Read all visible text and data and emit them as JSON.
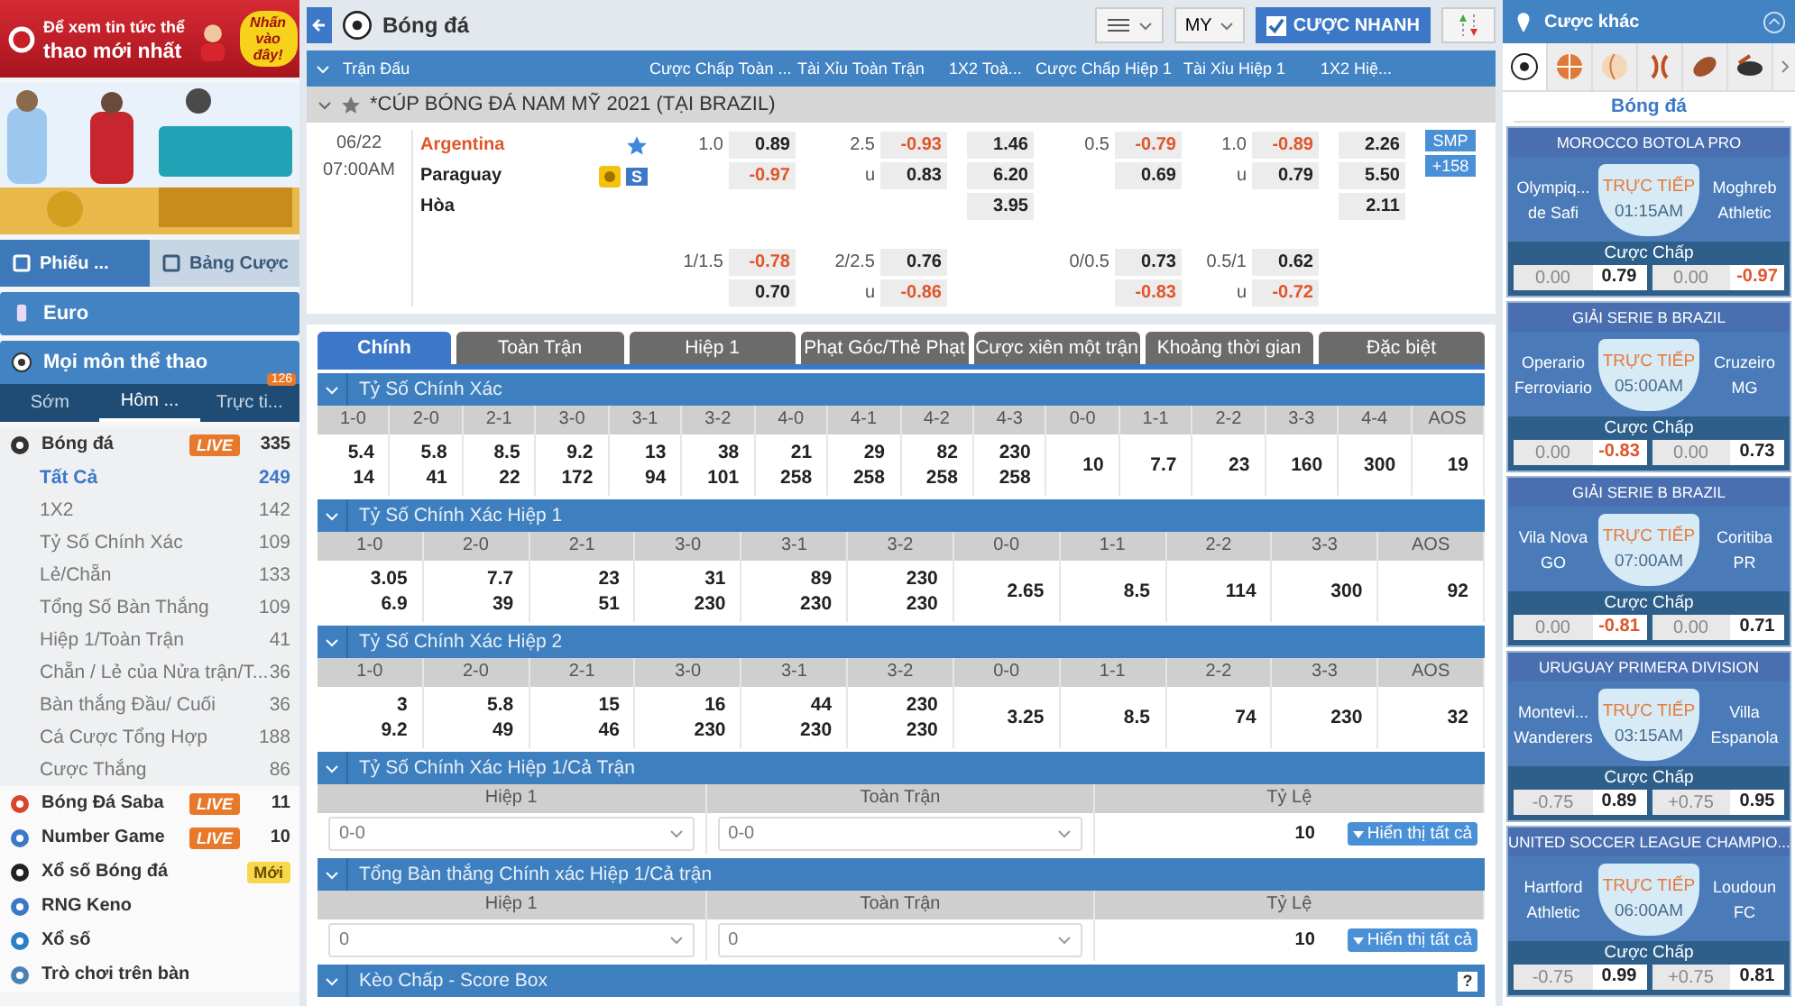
{
  "sidebar": {
    "promo_banner": {
      "line_1": "Để xem tin tức thể",
      "line_2": "thao mới nhất",
      "callout": "Nhấn vào đây!"
    },
    "slip_tabs": [
      {
        "label": "Phiếu ...",
        "selected": true
      },
      {
        "label": "Bảng Cược",
        "selected": false
      }
    ],
    "euro": "Euro",
    "all_sports": "Mọi môn thể thao",
    "period_tabs": [
      {
        "label": "Sớm",
        "selected": false
      },
      {
        "label": "Hôm ...",
        "selected": true
      },
      {
        "label": "Trực ti...",
        "selected": false,
        "badge": "126"
      }
    ],
    "sports": [
      {
        "name": "Bóng đá",
        "badge": {
          "kind": "live",
          "text": "LIVE"
        },
        "count": "335",
        "expanded": true,
        "children": [
          {
            "name": "Tất Cả",
            "count": "249",
            "selected": true
          },
          {
            "name": "1X2",
            "count": "142",
            "selected": false
          },
          {
            "name": "Tỷ Số Chính Xác",
            "count": "109",
            "selected": false
          },
          {
            "name": "Lẻ/Chẵn",
            "count": "133",
            "selected": false
          },
          {
            "name": "Tổng Số Bàn Thắng",
            "count": "109",
            "selected": false
          },
          {
            "name": "Hiệp 1/Toàn Trận",
            "count": "41",
            "selected": false
          },
          {
            "name": "Chẵn / Lẻ của Nửa trận/T...",
            "count": "36",
            "selected": false
          },
          {
            "name": "Bàn thắng Đầu/ Cuối",
            "count": "36",
            "selected": false
          },
          {
            "name": "Cá Cược Tổng Hợp",
            "count": "188",
            "selected": false
          },
          {
            "name": "Cược Thắng",
            "count": "86",
            "selected": false
          }
        ]
      },
      {
        "name": "Bóng Đá Saba",
        "badge": {
          "kind": "live",
          "text": "LIVE"
        },
        "count": "11",
        "expanded": false
      },
      {
        "name": "Number Game",
        "badge": {
          "kind": "live",
          "text": "LIVE"
        },
        "count": "10",
        "expanded": false
      },
      {
        "name": "Xổ số Bóng đá",
        "badge": {
          "kind": "new",
          "text": "Mới"
        },
        "expanded": false
      },
      {
        "name": "RNG Keno",
        "expanded": false
      },
      {
        "name": "Xổ số",
        "expanded": false
      },
      {
        "name": "Trò chơi trên bàn",
        "expanded": false
      }
    ]
  },
  "header": {
    "title": "Bóng đá",
    "odds_format": "MY",
    "quick_bet": {
      "label": "CƯỢC NHANH",
      "checked": true
    }
  },
  "columns": [
    "Trận Đấu",
    "Cược Chấp Toàn ...",
    "Tài Xỉu Toàn Trận",
    "1X2 Toà...",
    "Cược Chấp Hiệp 1",
    "Tài Xỉu Hiệp 1",
    "1X2 Hiệ..."
  ],
  "league": "*CÚP BÓNG ĐÁ NAM MỸ 2021 (TẠI BRAZIL)",
  "match": {
    "date": "06/22",
    "time": "07:00AM",
    "teams": [
      {
        "name": "Argentina",
        "favored": true,
        "starred": true,
        "streaming": false
      },
      {
        "name": "Paraguay",
        "favored": false,
        "starred": false,
        "streaming": true,
        "tag": "S"
      },
      {
        "name": "Hòa",
        "favored": false,
        "starred": false,
        "streaming": false
      }
    ],
    "markets": [
      {
        "rows": [
          {
            "line": "1.0",
            "odds": "0.89"
          },
          {
            "odds": "-0.97"
          },
          {},
          {
            "line": "1/1.5",
            "odds": "-0.78"
          },
          {
            "odds": "0.70"
          }
        ]
      },
      {
        "rows": [
          {
            "line": "2.5",
            "odds": "-0.93"
          },
          {
            "line": "u",
            "odds": "0.83"
          },
          {},
          {
            "line": "2/2.5",
            "odds": "0.76"
          },
          {
            "line": "u",
            "odds": "-0.86"
          }
        ]
      },
      {
        "rows": [
          {
            "odds": "1.46"
          },
          {
            "odds": "6.20"
          },
          {
            "odds": "3.95"
          },
          {},
          {}
        ]
      },
      {
        "rows": [
          {
            "line": "0.5",
            "odds": "-0.79"
          },
          {
            "odds": "0.69"
          },
          {},
          {
            "line": "0/0.5",
            "odds": "0.73"
          },
          {
            "odds": "-0.83"
          }
        ]
      },
      {
        "rows": [
          {
            "line": "1.0",
            "odds": "-0.89"
          },
          {
            "line": "u",
            "odds": "0.79"
          },
          {},
          {
            "line": "0.5/1",
            "odds": "0.62"
          },
          {
            "line": "u",
            "odds": "-0.72"
          }
        ]
      },
      {
        "rows": [
          {
            "odds": "2.26"
          },
          {
            "odds": "5.50"
          },
          {
            "odds": "2.11"
          },
          {},
          {}
        ]
      }
    ],
    "smp": "SMP",
    "more": "+158"
  },
  "bet_tabs": [
    {
      "label": "Chính",
      "selected": true
    },
    {
      "label": "Toàn Trận",
      "selected": false
    },
    {
      "label": "Hiệp 1",
      "selected": false
    },
    {
      "label": "Phạt Góc/Thẻ Phạt",
      "selected": false
    },
    {
      "label": "Cược xiên một trận",
      "selected": false
    },
    {
      "label": "Khoảng thời gian",
      "selected": false
    },
    {
      "label": "Đặc biệt",
      "selected": false
    }
  ],
  "sections": [
    {
      "kind": "grid",
      "title": "Tỷ Số Chính Xác",
      "cells": [
        {
          "score": "1-0",
          "odds": [
            "5.4",
            "14"
          ]
        },
        {
          "score": "2-0",
          "odds": [
            "5.8",
            "41"
          ]
        },
        {
          "score": "2-1",
          "odds": [
            "8.5",
            "22"
          ]
        },
        {
          "score": "3-0",
          "odds": [
            "9.2",
            "172"
          ]
        },
        {
          "score": "3-1",
          "odds": [
            "13",
            "94"
          ]
        },
        {
          "score": "3-2",
          "odds": [
            "38",
            "101"
          ]
        },
        {
          "score": "4-0",
          "odds": [
            "21",
            "258"
          ]
        },
        {
          "score": "4-1",
          "odds": [
            "29",
            "258"
          ]
        },
        {
          "score": "4-2",
          "odds": [
            "82",
            "258"
          ]
        },
        {
          "score": "4-3",
          "odds": [
            "230",
            "258"
          ]
        },
        {
          "score": "0-0",
          "odds": [
            "10"
          ]
        },
        {
          "score": "1-1",
          "odds": [
            "7.7"
          ]
        },
        {
          "score": "2-2",
          "odds": [
            "23"
          ]
        },
        {
          "score": "3-3",
          "odds": [
            "160"
          ]
        },
        {
          "score": "4-4",
          "odds": [
            "300"
          ]
        },
        {
          "score": "AOS",
          "odds": [
            "19"
          ]
        }
      ]
    },
    {
      "kind": "grid",
      "title": "Tỷ Số Chính Xác Hiệp 1",
      "cells": [
        {
          "score": "1-0",
          "odds": [
            "3.05",
            "6.9"
          ]
        },
        {
          "score": "2-0",
          "odds": [
            "7.7",
            "39"
          ]
        },
        {
          "score": "2-1",
          "odds": [
            "23",
            "51"
          ]
        },
        {
          "score": "3-0",
          "odds": [
            "31",
            "230"
          ]
        },
        {
          "score": "3-1",
          "odds": [
            "89",
            "230"
          ]
        },
        {
          "score": "3-2",
          "odds": [
            "230",
            "230"
          ]
        },
        {
          "score": "0-0",
          "odds": [
            "2.65"
          ]
        },
        {
          "score": "1-1",
          "odds": [
            "8.5"
          ]
        },
        {
          "score": "2-2",
          "odds": [
            "114"
          ]
        },
        {
          "score": "3-3",
          "odds": [
            "300"
          ]
        },
        {
          "score": "AOS",
          "odds": [
            "92"
          ]
        }
      ]
    },
    {
      "kind": "grid",
      "title": "Tỷ Số Chính Xác Hiệp 2",
      "cells": [
        {
          "score": "1-0",
          "odds": [
            "3",
            "9.2"
          ]
        },
        {
          "score": "2-0",
          "odds": [
            "5.8",
            "49"
          ]
        },
        {
          "score": "2-1",
          "odds": [
            "15",
            "46"
          ]
        },
        {
          "score": "3-0",
          "odds": [
            "16",
            "230"
          ]
        },
        {
          "score": "3-1",
          "odds": [
            "44",
            "230"
          ]
        },
        {
          "score": "3-2",
          "odds": [
            "230",
            "230"
          ]
        },
        {
          "score": "0-0",
          "odds": [
            "3.25"
          ]
        },
        {
          "score": "1-1",
          "odds": [
            "8.5"
          ]
        },
        {
          "score": "2-2",
          "odds": [
            "74"
          ]
        },
        {
          "score": "3-3",
          "odds": [
            "230"
          ]
        },
        {
          "score": "AOS",
          "odds": [
            "32"
          ]
        }
      ]
    },
    {
      "kind": "combo",
      "title": "Tỷ Số Chính Xác Hiệp 1/Cả Trận",
      "columns": [
        "Hiệp 1",
        "Toàn Trận",
        "Tỷ Lệ"
      ],
      "selects": [
        "0-0",
        "0-0"
      ],
      "ratio": "10",
      "show_all": "Hiển thị tất cả"
    },
    {
      "kind": "combo",
      "title": "Tổng Bàn thắng Chính xác Hiệp 1/Cả trận",
      "columns": [
        "Hiệp 1",
        "Toàn Trận",
        "Tỷ Lệ"
      ],
      "selects": [
        "0",
        "0"
      ],
      "ratio": "10",
      "show_all": "Hiển thị tất cả"
    },
    {
      "kind": "bar",
      "title": "Kèo Chấp - Score Box",
      "help": "?"
    }
  ],
  "other_bets": {
    "title": "Cược khác",
    "sport_tabs": [
      {
        "kind": "soccer",
        "selected": true
      },
      {
        "kind": "basketball",
        "selected": false
      },
      {
        "kind": "volleyball",
        "selected": false
      },
      {
        "kind": "tennis",
        "selected": false
      },
      {
        "kind": "football",
        "selected": false
      },
      {
        "kind": "hockey",
        "selected": false
      }
    ],
    "sport_label": "Bóng đá",
    "cards": [
      {
        "league": "MOROCCO BOTOLA PRO",
        "home": [
          "Olympiq...",
          "de Safi"
        ],
        "away": [
          "Moghreb",
          "Athletic"
        ],
        "status": "TRỰC TIẾP",
        "time": "01:15AM",
        "market": "Cược Chấp",
        "odds": [
          {
            "line": "0.00",
            "odds": "0.79"
          },
          {
            "line": "0.00",
            "odds": "-0.97"
          }
        ]
      },
      {
        "league": "GIẢI SERIE B BRAZIL",
        "home": [
          "Operario",
          "Ferroviario"
        ],
        "away": [
          "Cruzeiro",
          "MG"
        ],
        "status": "TRỰC TIẾP",
        "time": "05:00AM",
        "market": "Cược Chấp",
        "odds": [
          {
            "line": "0.00",
            "odds": "-0.83"
          },
          {
            "line": "0.00",
            "odds": "0.73"
          }
        ]
      },
      {
        "league": "GIẢI SERIE B BRAZIL",
        "home": [
          "Vila Nova",
          "GO"
        ],
        "away": [
          "Coritiba",
          "PR"
        ],
        "status": "TRỰC TIẾP",
        "time": "07:00AM",
        "market": "Cược Chấp",
        "odds": [
          {
            "line": "0.00",
            "odds": "-0.81"
          },
          {
            "line": "0.00",
            "odds": "0.71"
          }
        ]
      },
      {
        "league": "URUGUAY PRIMERA DIVISION",
        "home": [
          "Montevi...",
          "Wanderers"
        ],
        "away": [
          "Villa",
          "Espanola"
        ],
        "status": "TRỰC TIẾP",
        "time": "03:15AM",
        "market": "Cược Chấp",
        "odds": [
          {
            "line": "-0.75",
            "odds": "0.89"
          },
          {
            "line": "+0.75",
            "odds": "0.95"
          }
        ]
      },
      {
        "league": "UNITED SOCCER LEAGUE CHAMPIO...",
        "home": [
          "Hartford",
          "Athletic"
        ],
        "away": [
          "Loudoun",
          "FC"
        ],
        "status": "TRỰC TIẾP",
        "time": "06:00AM",
        "market": "Cược Chấp",
        "odds": [
          {
            "line": "-0.75",
            "odds": "0.99"
          },
          {
            "line": "+0.75",
            "odds": "0.81"
          }
        ]
      }
    ]
  }
}
